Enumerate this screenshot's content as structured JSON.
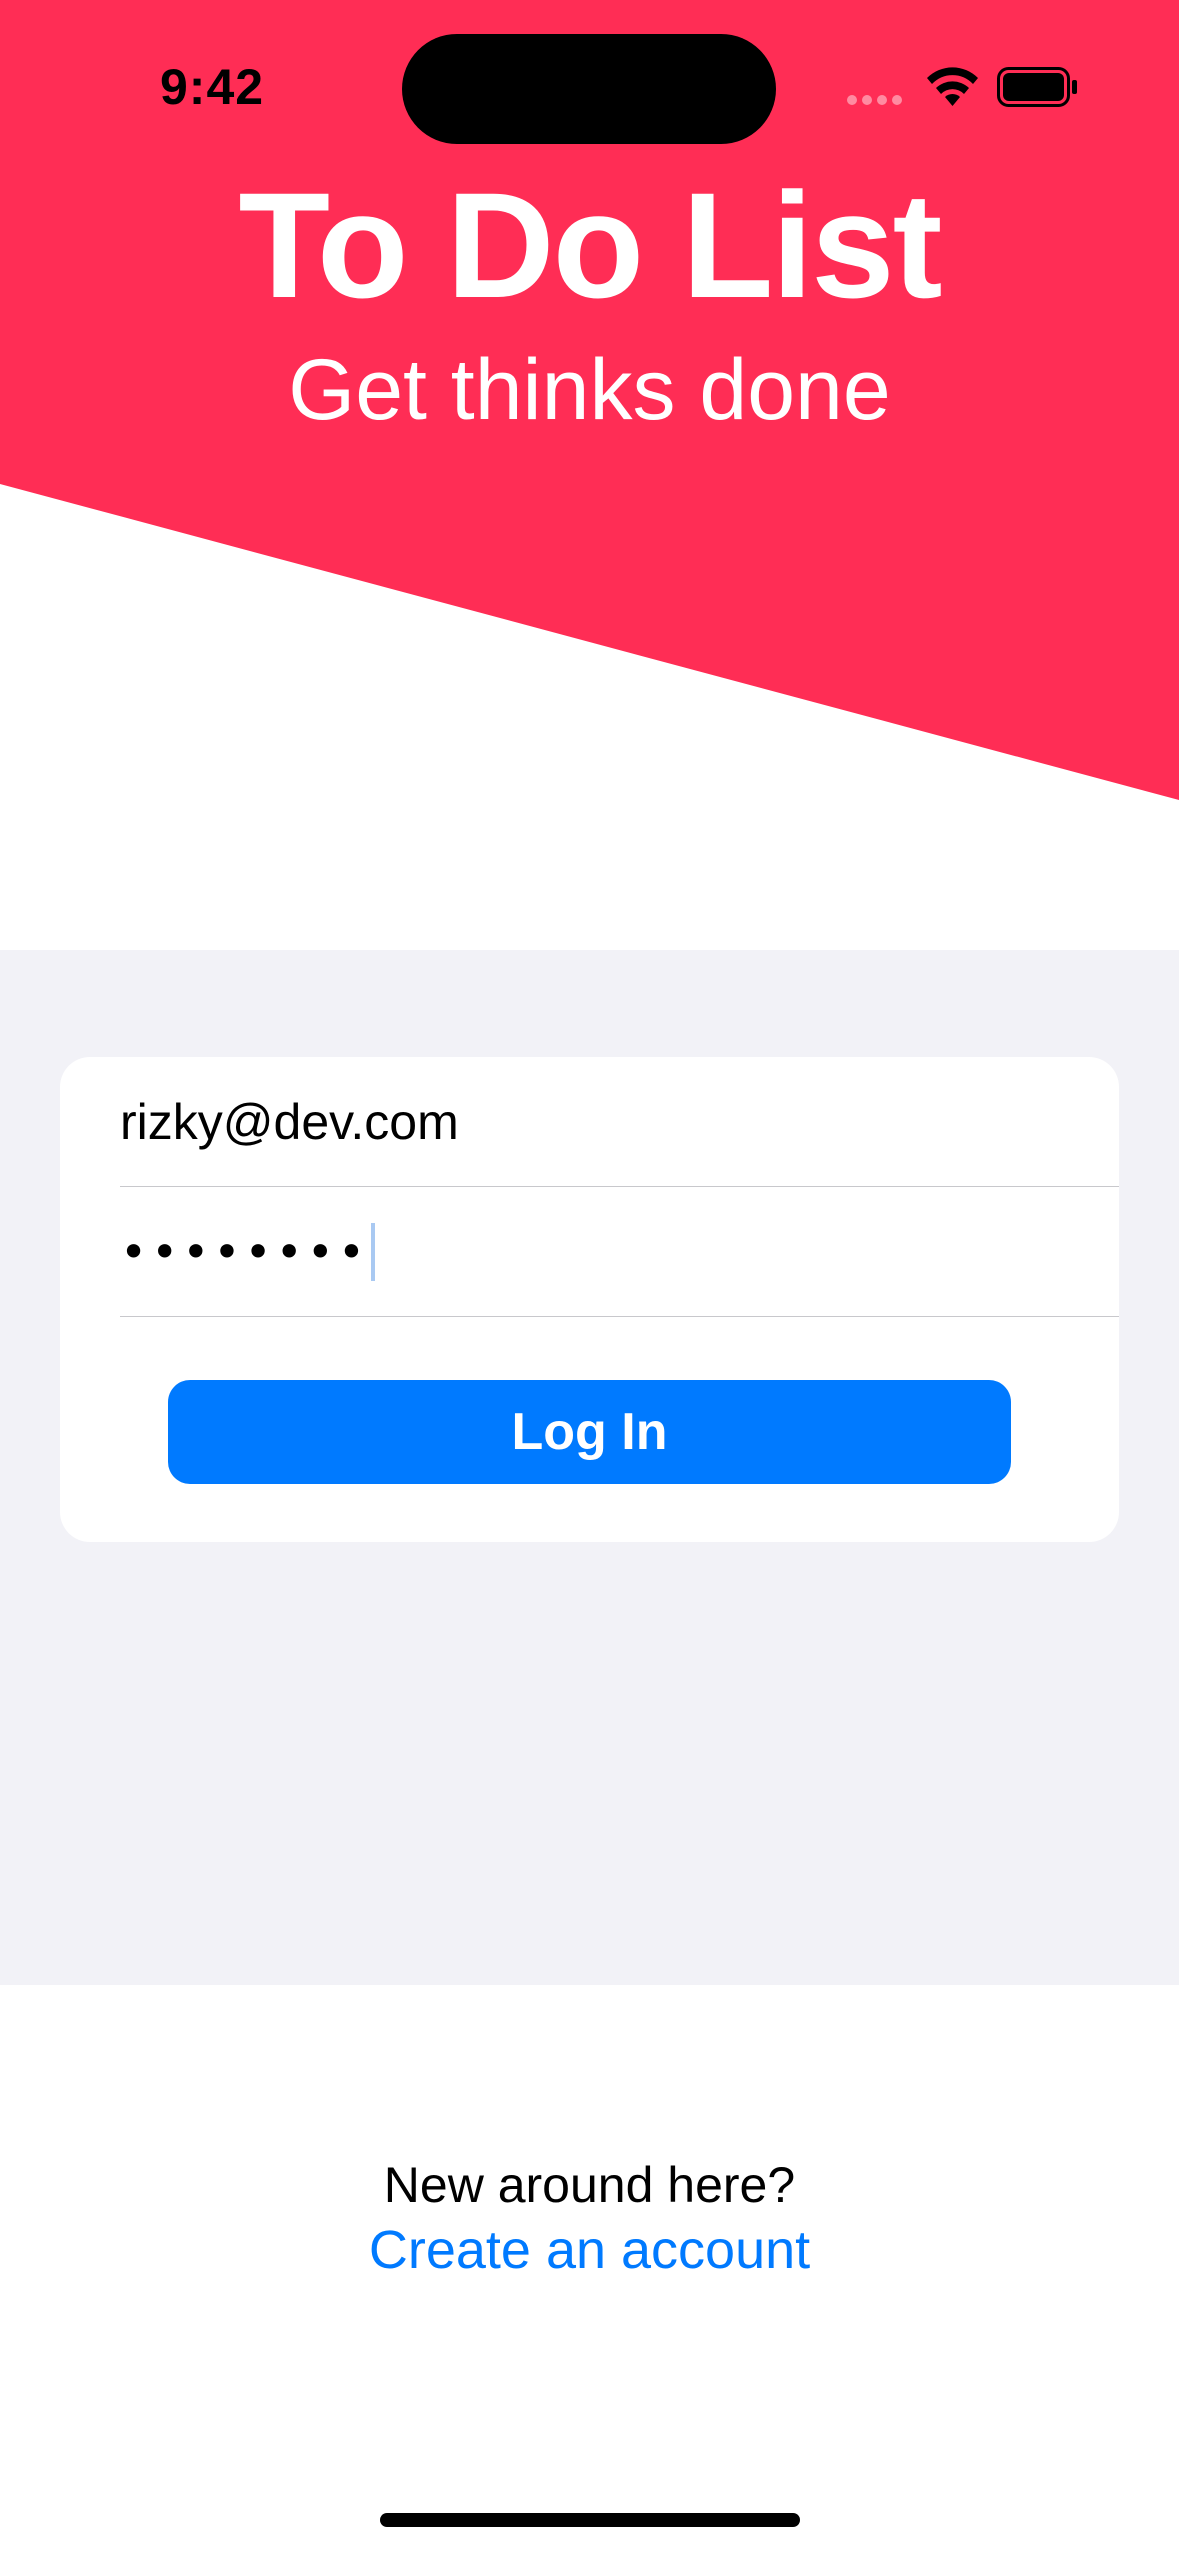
{
  "status_bar": {
    "time": "9:42"
  },
  "header": {
    "title": "To Do List",
    "subtitle": "Get thinks done",
    "background_color": "#ff2d55"
  },
  "login_form": {
    "email_value": "rizky@dev.com",
    "password_masked": "••••••••",
    "login_button_label": "Log In",
    "button_color": "#007aff",
    "section_background": "#f2f2f7"
  },
  "footer": {
    "prompt": "New around here?",
    "create_account_label": "Create an account",
    "link_color": "#007aff"
  }
}
